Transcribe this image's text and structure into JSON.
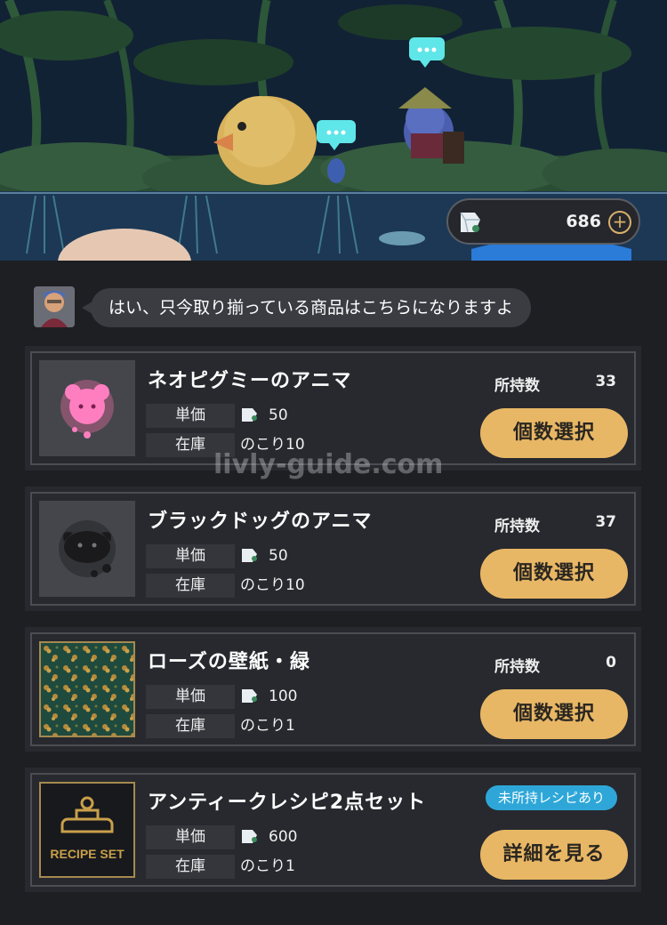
{
  "currency": {
    "amount": "686",
    "add_label": "+"
  },
  "npc": {
    "speech": "はい、只今取り揃っている商品はこちらになりますよ"
  },
  "labels": {
    "price": "単価",
    "stock": "在庫",
    "owned": "所持数"
  },
  "items": [
    {
      "name": "ネオピグミーのアニマ",
      "price": "50",
      "stock": "のこり10",
      "owned": "33",
      "button": "個数選択",
      "icon": "pink-anima-icon"
    },
    {
      "name": "ブラックドッグのアニマ",
      "price": "50",
      "stock": "のこり10",
      "owned": "37",
      "button": "個数選択",
      "icon": "black-dog-anima-icon"
    },
    {
      "name": "ローズの壁紙・緑",
      "price": "100",
      "stock": "のこり1",
      "owned": "0",
      "button": "個数選択",
      "icon": "rose-wallpaper-icon"
    },
    {
      "name": "アンティークレシピ2点セット",
      "price": "600",
      "stock": "のこり1",
      "badge": "未所持レシピあり",
      "button": "詳細を見る",
      "icon": "recipe-set-icon",
      "thumb_text": "RECIPE SET"
    }
  ],
  "watermark": "livly-guide.com",
  "colors": {
    "button": "#e8b765",
    "badge": "#2ea7d8",
    "panel": "#1e1f23",
    "card": "#27292e"
  }
}
